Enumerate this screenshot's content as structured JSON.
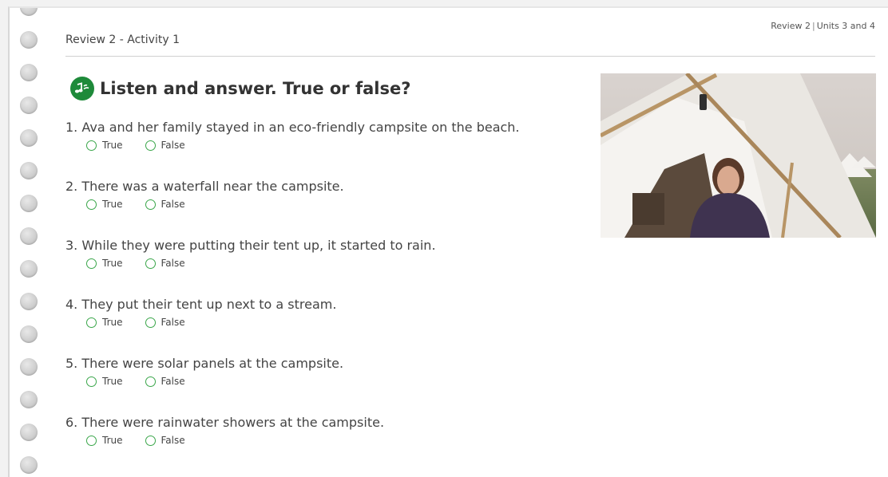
{
  "header": {
    "activity_title": "Review 2 - Activity 1",
    "breadcrumb_left": "Review 2",
    "breadcrumb_sep": "|",
    "breadcrumb_right": "Units 3 and 4"
  },
  "instruction": {
    "title": "Listen and answer. True or false?",
    "audio_icon": "music-notes-icon"
  },
  "questions": [
    {
      "number": "1.",
      "text": "Ava and her family stayed in an eco-friendly campsite on the beach.",
      "true_label": "True",
      "false_label": "False"
    },
    {
      "number": "2.",
      "text": "There was a waterfall near the campsite.",
      "true_label": "True",
      "false_label": "False"
    },
    {
      "number": "3.",
      "text": "While they were putting their tent up, it started to rain.",
      "true_label": "True",
      "false_label": "False"
    },
    {
      "number": "4.",
      "text": "They put their tent up next to a stream.",
      "true_label": "True",
      "false_label": "False"
    },
    {
      "number": "5.",
      "text": "There were solar panels at the campsite.",
      "true_label": "True",
      "false_label": "False"
    },
    {
      "number": "6.",
      "text": "There were rainwater showers at the campsite.",
      "true_label": "True",
      "false_label": "False"
    }
  ],
  "colors": {
    "accent_green": "#1e8a3a",
    "radio_green": "#3aa64a"
  }
}
